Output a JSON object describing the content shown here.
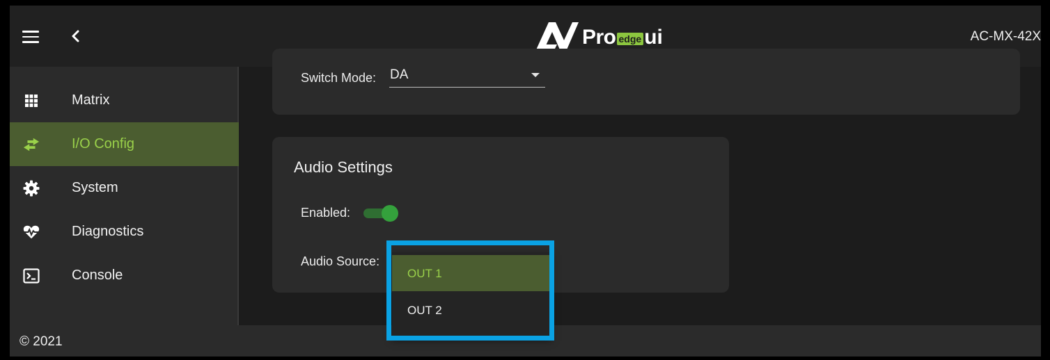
{
  "header": {
    "logo_text": "AVProedgeui",
    "logo_pro": "Pro",
    "logo_edge": "edge",
    "logo_ui": "ui",
    "model": "AC-MX-42X"
  },
  "sidebar": {
    "items": [
      {
        "label": "Matrix",
        "icon": "grid-icon"
      },
      {
        "label": "I/O Config",
        "icon": "swap-arrows-icon",
        "active": true
      },
      {
        "label": "System",
        "icon": "gear-icon"
      },
      {
        "label": "Diagnostics",
        "icon": "heart-pulse-icon"
      },
      {
        "label": "Console",
        "icon": "terminal-icon"
      }
    ]
  },
  "footer": {
    "copyright": "© 2021"
  },
  "switch_mode": {
    "label": "Switch Mode:",
    "value": "DA"
  },
  "audio_settings": {
    "title": "Audio Settings",
    "enabled_label": "Enabled:",
    "enabled": true,
    "source_label": "Audio Source:",
    "options": [
      {
        "label": "OUT 1",
        "selected": true
      },
      {
        "label": "OUT 2",
        "selected": false
      }
    ]
  },
  "colors": {
    "accent_green": "#9ad14a",
    "active_bg": "#4b5d30",
    "highlight_blue": "#0aa2e4",
    "toggle_green": "#34a13c"
  }
}
